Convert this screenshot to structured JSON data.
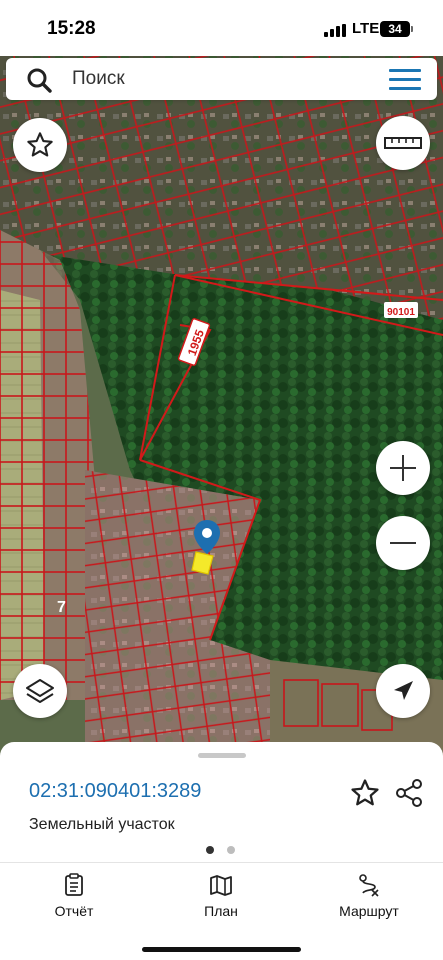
{
  "status_bar": {
    "time": "15:28",
    "network": "LTE",
    "battery": "34"
  },
  "search": {
    "placeholder": "Поиск"
  },
  "map": {
    "labels": {
      "quarter_code": "90101",
      "parcel_number": "1955"
    },
    "colors": {
      "boundary": "#d11a1a",
      "selected_parcel": "#f4e92a",
      "marker": "#1d6fb0"
    }
  },
  "parcel": {
    "cadastral_number": "02:31:090401:3289",
    "type": "Земельный участок"
  },
  "pager": {
    "active_index": 0,
    "total": 2
  },
  "tabs": [
    {
      "label": "Отчёт",
      "icon": "report-icon"
    },
    {
      "label": "План",
      "icon": "map-icon"
    },
    {
      "label": "Маршрут",
      "icon": "route-icon"
    }
  ],
  "icons": [
    "search-icon",
    "menu-icon",
    "star-icon",
    "ruler-icon",
    "zoom-in-icon",
    "zoom-out-icon",
    "layers-icon",
    "location-arrow-icon",
    "share-icon",
    "location-marker-icon"
  ]
}
